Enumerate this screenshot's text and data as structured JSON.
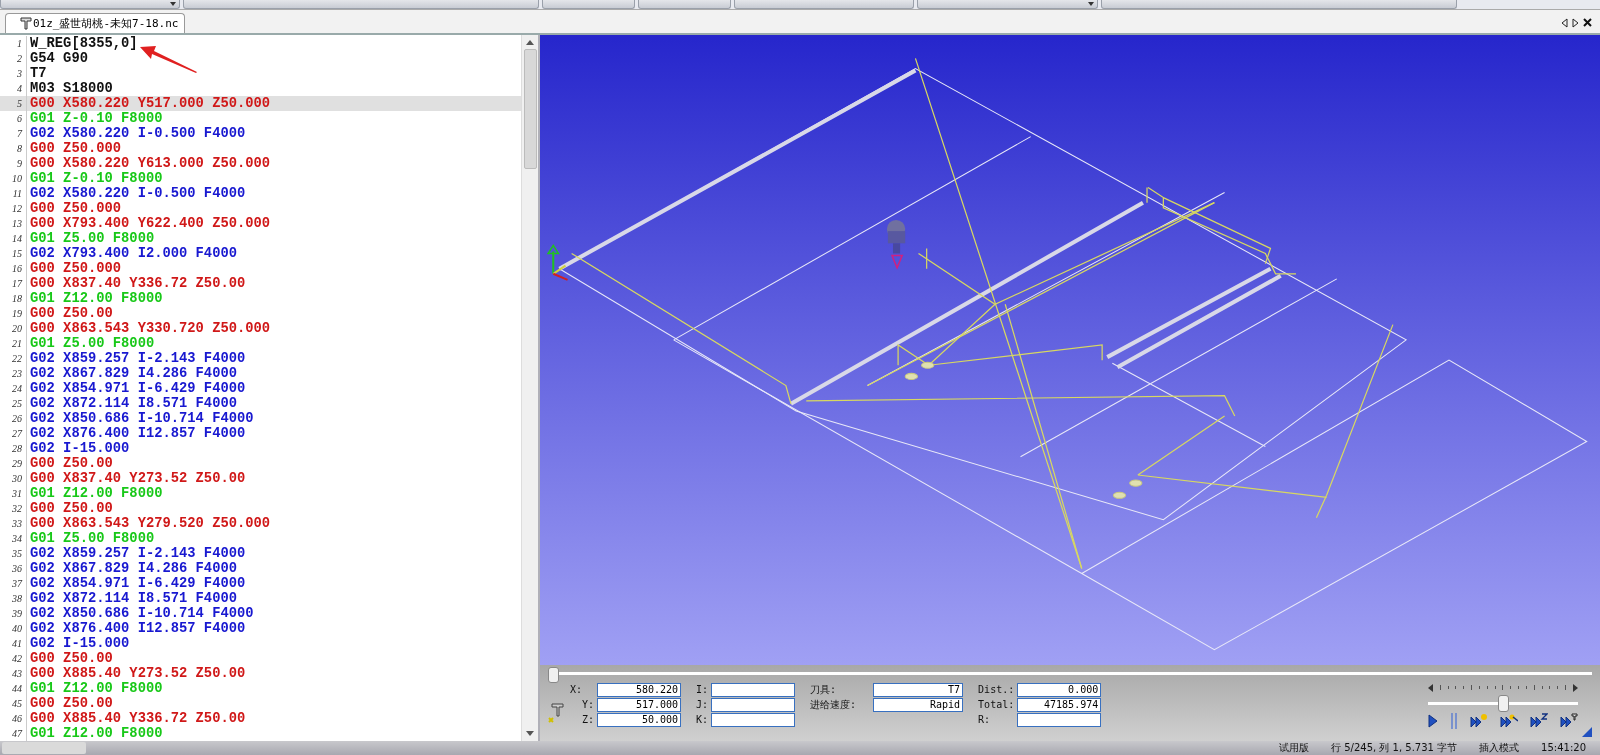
{
  "toolbar": {
    "buttons": [
      {
        "kind": "dropdown"
      },
      {
        "kind": "plain"
      },
      {
        "kind": "plain"
      },
      {
        "kind": "plain"
      },
      {
        "kind": "plain"
      },
      {
        "kind": "dropdown"
      },
      {
        "kind": "plain"
      }
    ]
  },
  "tab": {
    "label": "01z_盛世胡桃-未知7-18.nc",
    "selected": true
  },
  "editor": {
    "lines": [
      {
        "number": "1",
        "text": "W_REG[8355,0]",
        "kind": "plain",
        "selected": false
      },
      {
        "number": "2",
        "text": "G54 G90",
        "kind": "plain",
        "selected": false
      },
      {
        "number": "3",
        "text": "T7",
        "kind": "plain",
        "selected": false
      },
      {
        "number": "4",
        "text": "M03 S18000",
        "kind": "plain",
        "selected": false
      },
      {
        "number": "5",
        "text": "G00 X580.220 Y517.000 Z50.000",
        "kind": "rapid",
        "selected": true
      },
      {
        "number": "6",
        "text": "G01 Z-0.10 F8000",
        "kind": "linear",
        "selected": false
      },
      {
        "number": "7",
        "text": "G02 X580.220 I-0.500 F4000",
        "kind": "arc",
        "selected": false
      },
      {
        "number": "8",
        "text": "G00 Z50.000",
        "kind": "rapid",
        "selected": false
      },
      {
        "number": "9",
        "text": "G00 X580.220 Y613.000 Z50.000",
        "kind": "rapid",
        "selected": false
      },
      {
        "number": "10",
        "text": "G01 Z-0.10 F8000",
        "kind": "linear",
        "selected": false
      },
      {
        "number": "11",
        "text": "G02 X580.220 I-0.500 F4000",
        "kind": "arc",
        "selected": false
      },
      {
        "number": "12",
        "text": "G00 Z50.000",
        "kind": "rapid",
        "selected": false
      },
      {
        "number": "13",
        "text": "G00 X793.400 Y622.400 Z50.000",
        "kind": "rapid",
        "selected": false
      },
      {
        "number": "14",
        "text": "G01 Z5.00 F8000",
        "kind": "linear",
        "selected": false
      },
      {
        "number": "15",
        "text": "G02 X793.400 I2.000 F4000",
        "kind": "arc",
        "selected": false
      },
      {
        "number": "16",
        "text": "G00 Z50.000",
        "kind": "rapid",
        "selected": false
      },
      {
        "number": "17",
        "text": "G00 X837.40 Y336.72 Z50.00",
        "kind": "rapid",
        "selected": false
      },
      {
        "number": "18",
        "text": "G01 Z12.00 F8000",
        "kind": "linear",
        "selected": false
      },
      {
        "number": "19",
        "text": "G00 Z50.00",
        "kind": "rapid",
        "selected": false
      },
      {
        "number": "20",
        "text": "G00 X863.543 Y330.720 Z50.000",
        "kind": "rapid",
        "selected": false
      },
      {
        "number": "21",
        "text": "G01 Z5.00 F8000",
        "kind": "linear",
        "selected": false
      },
      {
        "number": "22",
        "text": "G02 X859.257 I-2.143 F4000",
        "kind": "arc",
        "selected": false
      },
      {
        "number": "23",
        "text": "G02 X867.829 I4.286 F4000",
        "kind": "arc",
        "selected": false
      },
      {
        "number": "24",
        "text": "G02 X854.971 I-6.429 F4000",
        "kind": "arc",
        "selected": false
      },
      {
        "number": "25",
        "text": "G02 X872.114 I8.571 F4000",
        "kind": "arc",
        "selected": false
      },
      {
        "number": "26",
        "text": "G02 X850.686 I-10.714 F4000",
        "kind": "arc",
        "selected": false
      },
      {
        "number": "27",
        "text": "G02 X876.400 I12.857 F4000",
        "kind": "arc",
        "selected": false
      },
      {
        "number": "28",
        "text": "G02 I-15.000",
        "kind": "arc",
        "selected": false
      },
      {
        "number": "29",
        "text": "G00 Z50.00",
        "kind": "rapid",
        "selected": false
      },
      {
        "number": "30",
        "text": "G00 X837.40 Y273.52 Z50.00",
        "kind": "rapid",
        "selected": false
      },
      {
        "number": "31",
        "text": "G01 Z12.00 F8000",
        "kind": "linear",
        "selected": false
      },
      {
        "number": "32",
        "text": "G00 Z50.00",
        "kind": "rapid",
        "selected": false
      },
      {
        "number": "33",
        "text": "G00 X863.543 Y279.520 Z50.000",
        "kind": "rapid",
        "selected": false
      },
      {
        "number": "34",
        "text": "G01 Z5.00 F8000",
        "kind": "linear",
        "selected": false
      },
      {
        "number": "35",
        "text": "G02 X859.257 I-2.143 F4000",
        "kind": "arc",
        "selected": false
      },
      {
        "number": "36",
        "text": "G02 X867.829 I4.286 F4000",
        "kind": "arc",
        "selected": false
      },
      {
        "number": "37",
        "text": "G02 X854.971 I-6.429 F4000",
        "kind": "arc",
        "selected": false
      },
      {
        "number": "38",
        "text": "G02 X872.114 I8.571 F4000",
        "kind": "arc",
        "selected": false
      },
      {
        "number": "39",
        "text": "G02 X850.686 I-10.714 F4000",
        "kind": "arc",
        "selected": false
      },
      {
        "number": "40",
        "text": "G02 X876.400 I12.857 F4000",
        "kind": "arc",
        "selected": false
      },
      {
        "number": "41",
        "text": "G02 I-15.000",
        "kind": "arc",
        "selected": false
      },
      {
        "number": "42",
        "text": "G00 Z50.00",
        "kind": "rapid",
        "selected": false
      },
      {
        "number": "43",
        "text": "G00 X885.40 Y273.52 Z50.00",
        "kind": "rapid",
        "selected": false
      },
      {
        "number": "44",
        "text": "G01 Z12.00 F8000",
        "kind": "linear",
        "selected": false
      },
      {
        "number": "45",
        "text": "G00 Z50.00",
        "kind": "rapid",
        "selected": false
      },
      {
        "number": "46",
        "text": "G00 X885.40 Y336.72 Z50.00",
        "kind": "rapid",
        "selected": false
      },
      {
        "number": "47",
        "text": "G01 Z12.00 F8000",
        "kind": "linear",
        "selected": false
      }
    ]
  },
  "simulation": {
    "timeline": {
      "level": 0.0
    },
    "fields": [
      {
        "label": "X:",
        "value": "580.220"
      },
      {
        "label": "I:"
      },
      {
        "label": "刀具:",
        "value": "T7"
      },
      {
        "label": "Dist.:",
        "value": "0.000"
      },
      {
        "label": "Y:",
        "value": "517.000"
      },
      {
        "label": "J:"
      },
      {
        "label": "进给速度:",
        "value": "Rapid"
      },
      {
        "label": "Total:",
        "value": "47185.974"
      },
      {
        "label": "Z:",
        "value": "50.000"
      },
      {
        "label": "K:"
      },
      {
        "label": "R:"
      }
    ],
    "speed": {
      "level": 0.5
    },
    "controls": [
      {
        "kind": "play"
      },
      {
        "kind": "pause"
      },
      {
        "kind": "step-point"
      },
      {
        "kind": "step-move"
      },
      {
        "kind": "step-z"
      },
      {
        "kind": "step-tool"
      }
    ]
  },
  "status_bar": {
    "items": [
      "试用版",
      "行 5/245, 列 1, 5.731 字节",
      "插入模式",
      "15:41:20"
    ]
  }
}
